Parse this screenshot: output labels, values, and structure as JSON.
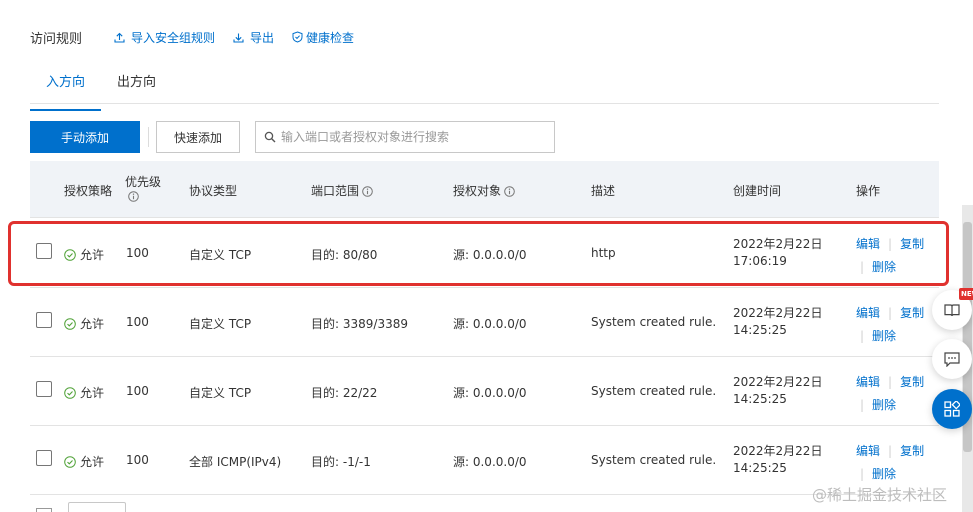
{
  "section_title": "访问规则",
  "toolbar": {
    "import_label": "导入安全组规则",
    "export_label": "导出",
    "health_label": "健康检查"
  },
  "tabs": [
    {
      "label": "入方向",
      "active": true
    },
    {
      "label": "出方向",
      "active": false
    }
  ],
  "actions": {
    "manual_add_label": "手动添加",
    "quick_add_label": "快速添加",
    "search_placeholder": "输入端口或者授权对象进行搜索"
  },
  "columns": {
    "policy": "授权策略",
    "priority": "优先级",
    "protocol": "协议类型",
    "port": "端口范围",
    "source": "授权对象",
    "description": "描述",
    "created": "创建时间",
    "ops": "操作"
  },
  "rows": [
    {
      "policy": "允许",
      "priority": "100",
      "protocol": "自定义 TCP",
      "port": "目的: 80/80",
      "source": "源: 0.0.0.0/0",
      "description": "http",
      "date": "2022年2月22日",
      "time": "17:06:19",
      "highlighted": true
    },
    {
      "policy": "允许",
      "priority": "100",
      "protocol": "自定义 TCP",
      "port": "目的: 3389/3389",
      "source": "源: 0.0.0.0/0",
      "description": "System created rule.",
      "date": "2022年2月22日",
      "time": "14:25:25",
      "highlighted": false
    },
    {
      "policy": "允许",
      "priority": "100",
      "protocol": "自定义 TCP",
      "port": "目的: 22/22",
      "source": "源: 0.0.0.0/0",
      "description": "System created rule.",
      "date": "2022年2月22日",
      "time": "14:25:25",
      "highlighted": false
    },
    {
      "policy": "允许",
      "priority": "100",
      "protocol": "全部 ICMP(IPv4)",
      "port": "目的: -1/-1",
      "source": "源: 0.0.0.0/0",
      "description": "System created rule.",
      "date": "2022年2月22日",
      "time": "14:25:25",
      "highlighted": false
    }
  ],
  "row_ops": {
    "edit": "编辑",
    "copy": "复制",
    "delete": "删除",
    "separator": "|"
  },
  "float": {
    "new_badge": "NEW"
  },
  "watermark": "@稀土掘金技术社区",
  "colors": {
    "accent": "#0070cc",
    "allow_green": "#52a33a",
    "highlight_red": "#e0312e",
    "header_bg": "#f0f3f7"
  }
}
